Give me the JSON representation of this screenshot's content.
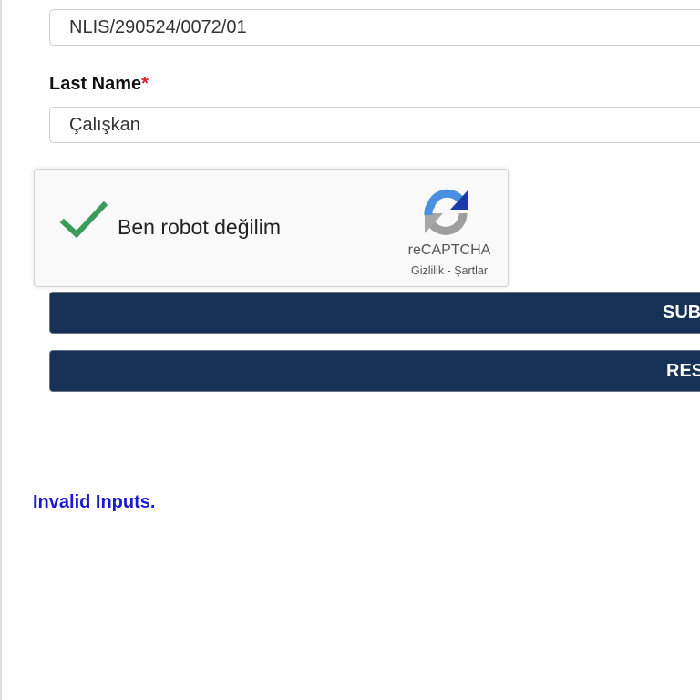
{
  "form": {
    "reference_field": {
      "value": "NLIS/290524/0072/01"
    },
    "last_name": {
      "label": "Last Name",
      "required_marker": "*",
      "value": "Çalışkan"
    }
  },
  "recaptcha": {
    "label": "Ben robot değilim",
    "brand": "reCAPTCHA",
    "privacy_link": "Gizlilik",
    "separator": " - ",
    "terms_link": "Şartlar",
    "checked": true,
    "check_color": "#3a9b5c",
    "logo_icon": "recaptcha-logo-icon"
  },
  "buttons": {
    "submit_label": "SUBMIT",
    "reset_label": "RESET",
    "color": "#163056"
  },
  "status": {
    "message": "Invalid Inputs.",
    "color": "#1a1ad0"
  }
}
